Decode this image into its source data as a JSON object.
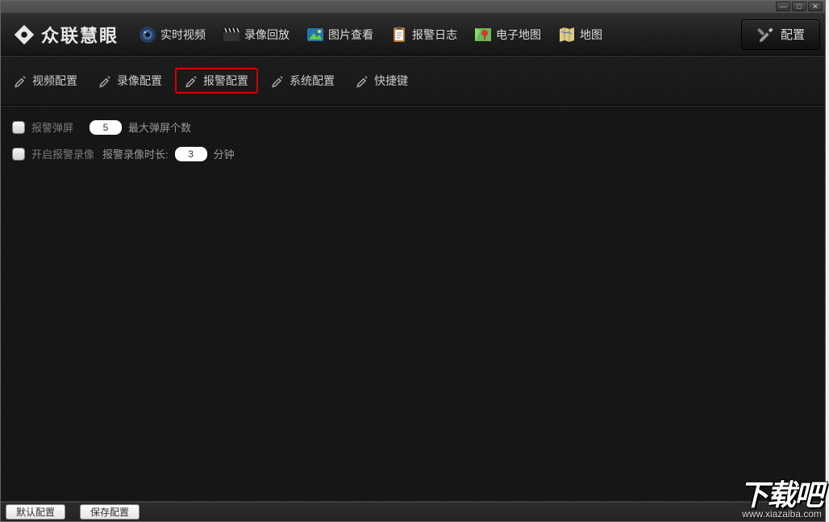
{
  "brand": "众联慧眼",
  "window": {
    "min": "—",
    "max": "□",
    "close": "✕"
  },
  "nav": {
    "items": [
      {
        "label": "实时视频"
      },
      {
        "label": "录像回放"
      },
      {
        "label": "图片查看"
      },
      {
        "label": "报警日志"
      },
      {
        "label": "电子地图"
      },
      {
        "label": "地图"
      }
    ],
    "settings": "配置"
  },
  "subnav": {
    "items": [
      {
        "label": "视频配置"
      },
      {
        "label": "录像配置"
      },
      {
        "label": "报警配置"
      },
      {
        "label": "系统配置"
      },
      {
        "label": "快捷键"
      }
    ],
    "selected": 2
  },
  "form": {
    "alarm_popup_label": "报警弹屏",
    "max_popup_value": "5",
    "max_popup_suffix": "最大弹屏个数",
    "enable_record_label": "开启报警录像",
    "record_dur_prefix": "报警录像时长:",
    "record_dur_value": "3",
    "record_dur_suffix": "分钟"
  },
  "footer": {
    "default": "默认配置",
    "save": "保存配置"
  },
  "watermark": {
    "text": "下载吧",
    "url": "www.xiazaiba.com"
  }
}
